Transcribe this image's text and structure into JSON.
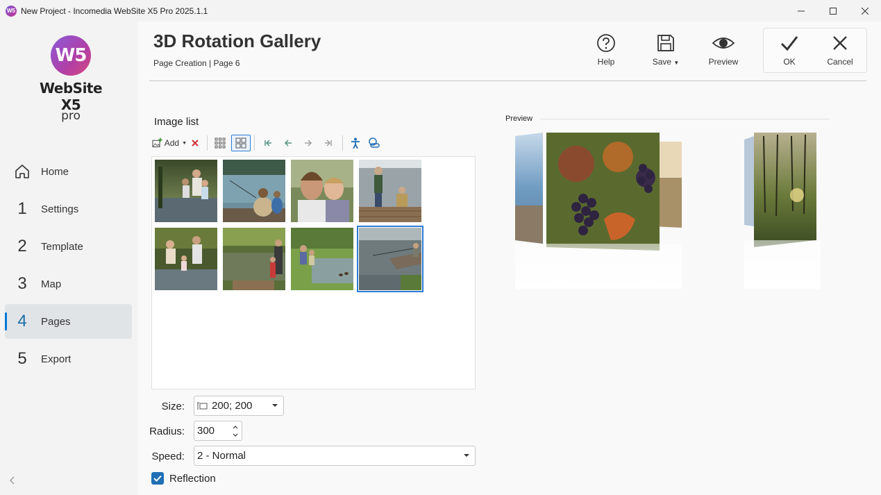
{
  "window": {
    "title": "New Project - Incomedia WebSite X5 Pro 2025.1.1",
    "app_icon": "W5"
  },
  "logo": {
    "mark": "W5",
    "name": "WebSite X5",
    "edition": "pro"
  },
  "nav": {
    "items": [
      {
        "num": "",
        "icon": "home-icon",
        "label": "Home",
        "active": false
      },
      {
        "num": "1",
        "label": "Settings",
        "active": false
      },
      {
        "num": "2",
        "label": "Template",
        "active": false
      },
      {
        "num": "3",
        "label": "Map",
        "active": false
      },
      {
        "num": "4",
        "label": "Pages",
        "active": true
      },
      {
        "num": "5",
        "label": "Export",
        "active": false
      }
    ]
  },
  "header": {
    "title": "3D Rotation Gallery",
    "breadcrumb": "Page Creation | Page 6",
    "help_label": "Help",
    "save_label": "Save",
    "preview_label": "Preview",
    "ok_label": "OK",
    "cancel_label": "Cancel"
  },
  "image_list": {
    "label": "Image list",
    "add_label": "Add",
    "selected_index": 7,
    "thumbnails": [
      "family-by-lake",
      "father-and-son-fishing",
      "father-kissing-child",
      "boys-on-dock",
      "family-in-water",
      "family-at-pond",
      "kids-fishing-by-river",
      "dock-fishing-lake"
    ]
  },
  "preview": {
    "label": "Preview"
  },
  "form": {
    "size_label": "Size:",
    "size_value": "200; 200",
    "radius_label": "Radius:",
    "radius_value": "300",
    "speed_label": "Speed:",
    "speed_value": "2 - Normal",
    "reflection_label": "Reflection",
    "reflection_checked": true
  },
  "colors": {
    "accent": "#0078d4",
    "active_num": "#1b6ea8",
    "delete": "#d13438"
  }
}
